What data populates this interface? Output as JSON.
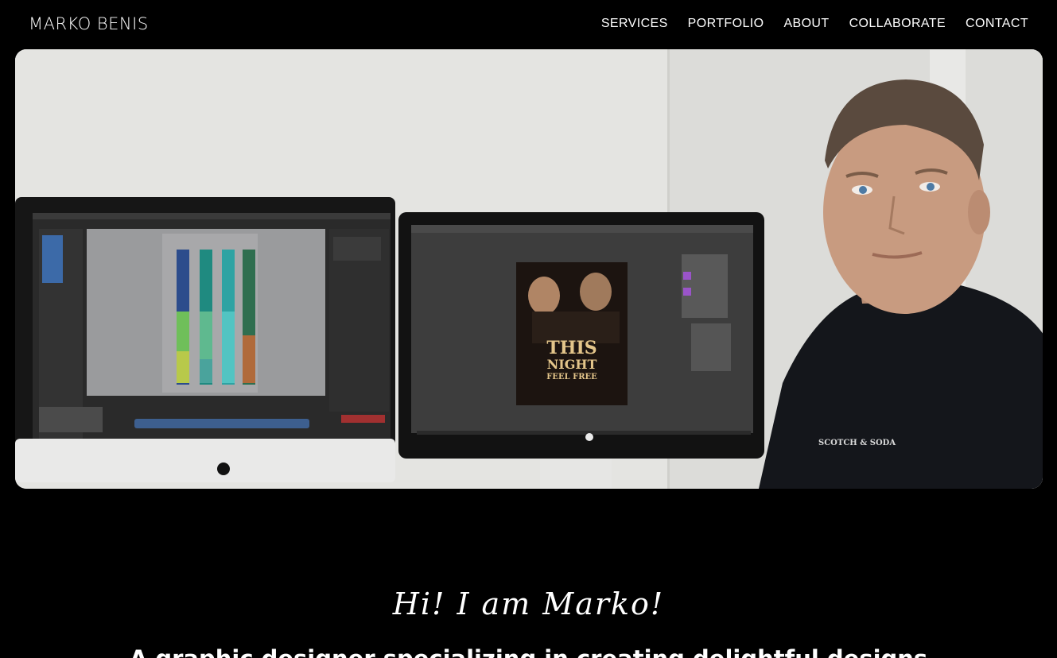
{
  "header": {
    "logo": "MARKO BENIS",
    "nav": [
      "SERVICES",
      "PORTFOLIO",
      "ABOUT",
      "COLLABORATE",
      "CONTACT"
    ]
  },
  "hero": {
    "poster_line1": "THIS",
    "poster_line2": "NIGHT",
    "poster_line3": "FEEL FREE",
    "shirt_text": "SCOTCH & SODA"
  },
  "intro": {
    "greeting": "Hi! I am Marko!",
    "tagline": "A graphic designer specializing in creating delightful designs"
  },
  "colors": {
    "background": "#000000",
    "text": "#ffffff"
  }
}
